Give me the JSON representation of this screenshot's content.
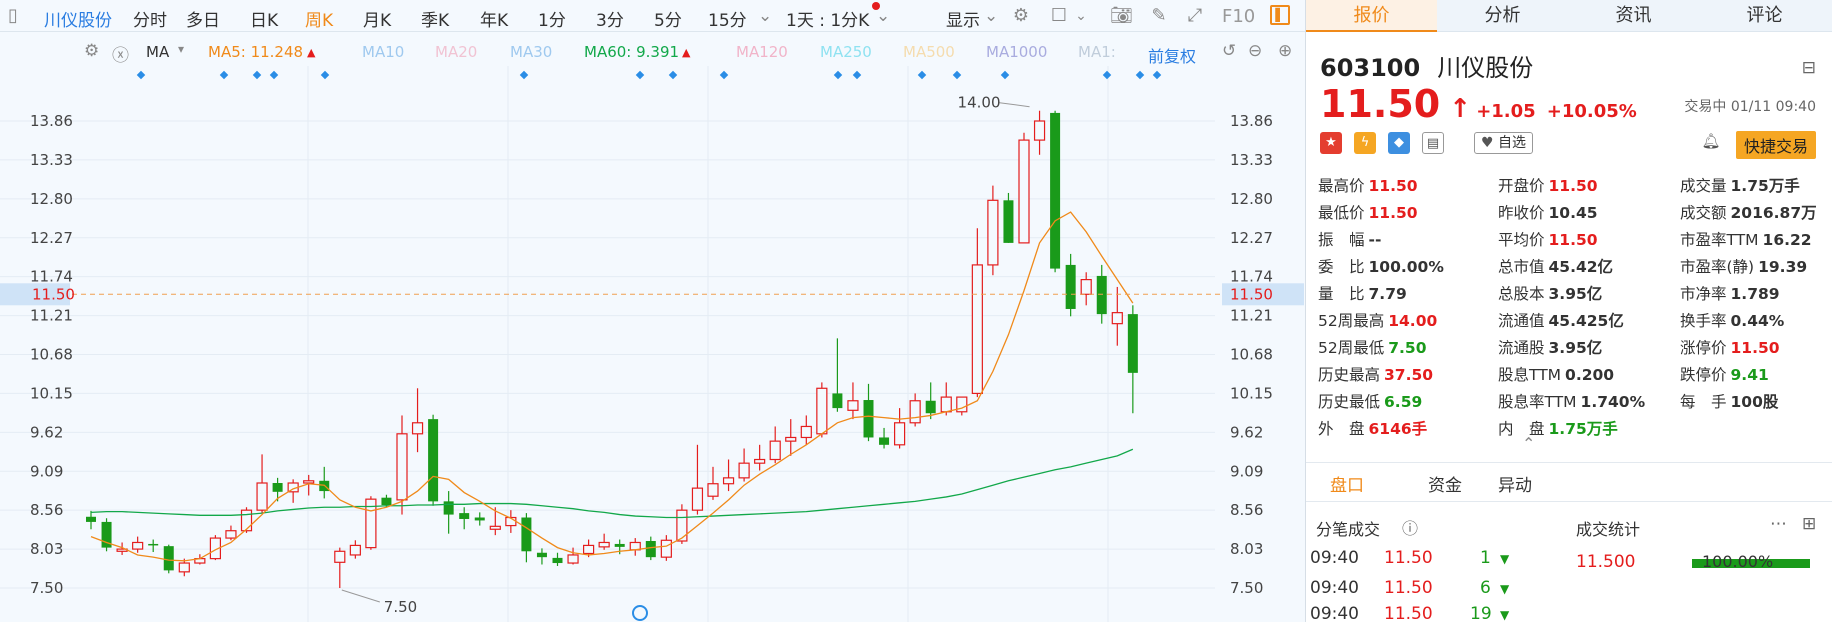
{
  "toolbar": {
    "stock_name": "川仪股份",
    "periods": [
      "分时",
      "多日",
      "日K",
      "周K",
      "月K",
      "季K",
      "年K",
      "1分",
      "3分",
      "5分",
      "15分"
    ],
    "active_period": "周K",
    "interval_label": "1天 : 1分K",
    "display_label": "显示",
    "f10_label": "F10"
  },
  "ma_bar": {
    "ma_label": "MA",
    "ma5_label": "MA5: 11.248",
    "ma10_label": "MA10",
    "ma20_label": "MA20",
    "ma30_label": "MA30",
    "ma60_label": "MA60: 9.391",
    "ma120_label": "MA120",
    "ma250_label": "MA250",
    "ma500_label": "MA500",
    "ma1000_label": "MA1000",
    "ma1_label": "MA1:",
    "adjust_label": "前复权",
    "colors": {
      "ma5": "#f08a1a",
      "ma60": "#12a84a",
      "ma10": "#7fb7ee",
      "ma20": "#f3b4c9",
      "ma30": "#8fc2ec",
      "ma120": "#f3a4c1",
      "ma250": "#7fe0f0",
      "ma500": "#f7d9a6",
      "ma1000": "#9b9fe0",
      "ma1": "#b8c7d8"
    }
  },
  "chart_data": {
    "type": "candlestick",
    "y_ticks": [
      "13.86",
      "13.33",
      "12.80",
      "12.27",
      "11.74",
      "11.21",
      "10.68",
      "10.15",
      "9.62",
      "9.09",
      "8.56",
      "8.03",
      "7.50"
    ],
    "ylim": [
      7.22,
      14.35
    ],
    "current_price_label": "11.50",
    "current_price": 11.5,
    "high_label": "14.00",
    "low_label": "7.50",
    "up_color": "#e41d1d",
    "down_color": "#1a9a1a",
    "candles": [
      [
        8.47,
        8.4,
        8.55,
        8.3
      ],
      [
        8.4,
        8.05,
        8.45,
        8.0
      ],
      [
        8.0,
        8.03,
        8.12,
        7.95
      ],
      [
        8.03,
        8.12,
        8.2,
        7.98
      ],
      [
        8.1,
        8.08,
        8.16,
        7.99
      ],
      [
        8.07,
        7.74,
        8.09,
        7.7
      ],
      [
        7.72,
        7.84,
        7.9,
        7.66
      ],
      [
        7.84,
        7.9,
        7.96,
        7.82
      ],
      [
        7.9,
        8.18,
        8.22,
        7.88
      ],
      [
        8.18,
        8.28,
        8.35,
        8.15
      ],
      [
        8.28,
        8.56,
        8.6,
        8.25
      ],
      [
        8.56,
        8.93,
        9.32,
        8.52
      ],
      [
        8.93,
        8.81,
        9.0,
        8.68
      ],
      [
        8.81,
        8.93,
        8.98,
        8.66
      ],
      [
        8.93,
        8.96,
        9.04,
        8.76
      ],
      [
        8.96,
        8.82,
        9.15,
        8.72
      ],
      [
        7.85,
        8.0,
        8.05,
        7.5
      ],
      [
        7.95,
        8.08,
        8.15,
        7.9
      ],
      [
        8.05,
        8.71,
        8.75,
        8.02
      ],
      [
        8.73,
        8.63,
        8.77,
        8.6
      ],
      [
        8.7,
        9.6,
        9.85,
        8.5
      ],
      [
        9.6,
        9.75,
        10.22,
        9.35
      ],
      [
        9.8,
        8.68,
        9.86,
        8.62
      ],
      [
        8.68,
        8.5,
        8.82,
        8.24
      ],
      [
        8.52,
        8.44,
        8.6,
        8.3
      ],
      [
        8.46,
        8.42,
        8.53,
        8.35
      ],
      [
        8.3,
        8.34,
        8.6,
        8.22
      ],
      [
        8.35,
        8.46,
        8.56,
        8.25
      ],
      [
        8.46,
        8.0,
        8.52,
        7.85
      ],
      [
        7.98,
        7.92,
        8.04,
        7.82
      ],
      [
        7.91,
        7.84,
        7.98,
        7.8
      ],
      [
        7.84,
        7.95,
        8.05,
        7.82
      ],
      [
        7.97,
        8.08,
        8.16,
        7.92
      ],
      [
        8.06,
        8.12,
        8.24,
        8.02
      ],
      [
        8.1,
        8.06,
        8.16,
        7.96
      ],
      [
        8.02,
        8.12,
        8.18,
        7.94
      ],
      [
        8.14,
        7.92,
        8.2,
        7.88
      ],
      [
        7.92,
        8.15,
        8.22,
        7.87
      ],
      [
        8.14,
        8.56,
        8.64,
        8.1
      ],
      [
        8.56,
        8.86,
        9.45,
        8.5
      ],
      [
        8.75,
        8.92,
        9.15,
        8.7
      ],
      [
        8.92,
        9.0,
        9.25,
        8.82
      ],
      [
        9.0,
        9.2,
        9.4,
        8.95
      ],
      [
        9.2,
        9.25,
        9.45,
        9.1
      ],
      [
        9.25,
        9.5,
        9.7,
        9.2
      ],
      [
        9.5,
        9.55,
        9.8,
        9.3
      ],
      [
        9.55,
        9.7,
        9.85,
        9.45
      ],
      [
        9.6,
        10.22,
        10.3,
        9.55
      ],
      [
        10.15,
        9.95,
        10.9,
        9.9
      ],
      [
        9.92,
        10.05,
        10.3,
        9.8
      ],
      [
        10.06,
        9.55,
        10.28,
        9.5
      ],
      [
        9.55,
        9.45,
        9.68,
        9.4
      ],
      [
        9.45,
        9.75,
        9.95,
        9.4
      ],
      [
        9.75,
        10.05,
        10.15,
        9.7
      ],
      [
        10.05,
        9.88,
        10.3,
        9.8
      ],
      [
        9.9,
        10.1,
        10.3,
        9.85
      ],
      [
        9.9,
        10.1,
        10.1,
        9.85
      ],
      [
        10.15,
        11.9,
        12.4,
        10.1
      ],
      [
        11.9,
        12.78,
        12.98,
        11.76
      ],
      [
        12.78,
        12.2,
        12.88,
        12.2
      ],
      [
        12.2,
        13.6,
        13.7,
        12.2
      ],
      [
        13.6,
        13.86,
        14.0,
        13.4
      ],
      [
        13.97,
        11.85,
        14.0,
        11.8
      ],
      [
        11.9,
        11.3,
        12.05,
        11.2
      ],
      [
        11.5,
        11.7,
        11.8,
        11.35
      ],
      [
        11.75,
        11.23,
        11.9,
        11.1
      ],
      [
        11.1,
        11.25,
        11.6,
        10.8
      ],
      [
        11.23,
        10.43,
        11.35,
        9.88
      ]
    ],
    "ma5": [
      8.2,
      8.12,
      8.05,
      7.95,
      7.92,
      7.88,
      7.87,
      7.9,
      8.02,
      8.12,
      8.3,
      8.5,
      8.72,
      8.85,
      8.92,
      8.9,
      8.7,
      8.6,
      8.55,
      8.6,
      8.68,
      8.82,
      9.02,
      8.98,
      8.8,
      8.68,
      8.55,
      8.45,
      8.32,
      8.18,
      8.05,
      7.98,
      7.95,
      7.97,
      8.0,
      8.02,
      8.05,
      8.07,
      8.18,
      8.35,
      8.52,
      8.7,
      8.9,
      9.05,
      9.18,
      9.32,
      9.45,
      9.6,
      9.75,
      9.82,
      9.84,
      9.82,
      9.8,
      9.82,
      9.85,
      9.9,
      9.95,
      10.05,
      10.45,
      10.95,
      11.55,
      12.2,
      12.5,
      12.62,
      12.35,
      12.02,
      11.7,
      11.38
    ],
    "ma60": [
      8.53,
      8.54,
      8.54,
      8.53,
      8.52,
      8.51,
      8.5,
      8.49,
      8.49,
      8.49,
      8.5,
      8.52,
      8.55,
      8.57,
      8.59,
      8.6,
      8.6,
      8.61,
      8.61,
      8.62,
      8.62,
      8.63,
      8.63,
      8.64,
      8.64,
      8.65,
      8.65,
      8.65,
      8.64,
      8.62,
      8.6,
      8.58,
      8.55,
      8.53,
      8.5,
      8.48,
      8.47,
      8.46,
      8.46,
      8.47,
      8.48,
      8.49,
      8.5,
      8.51,
      8.52,
      8.53,
      8.54,
      8.56,
      8.58,
      8.6,
      8.62,
      8.64,
      8.66,
      8.68,
      8.71,
      8.74,
      8.78,
      8.84,
      8.9,
      8.96,
      9.01,
      9.06,
      9.11,
      9.15,
      9.2,
      9.25,
      9.3,
      9.39
    ]
  },
  "side": {
    "tabs": [
      "报价",
      "分析",
      "资讯",
      "评论"
    ],
    "active_tab": "报价",
    "code": "603100",
    "name": "川仪股份",
    "price": "11.50",
    "change": "+1.05",
    "change_pct": "+10.05%",
    "trade_time": "交易中 01/11 09:40",
    "fav_label": "自选",
    "quick_trade": "快捷交易",
    "quote_rows": [
      [
        {
          "k": "最高价",
          "v": "11.50",
          "c": "up"
        },
        {
          "k": "开盘价",
          "v": "11.50",
          "c": "up"
        },
        {
          "k": "成交量",
          "v": "1.75万手",
          "c": ""
        }
      ],
      [
        {
          "k": "最低价",
          "v": "11.50",
          "c": "up"
        },
        {
          "k": "昨收价",
          "v": "10.45",
          "c": ""
        },
        {
          "k": "成交额",
          "v": "2016.87万",
          "c": ""
        }
      ],
      [
        {
          "k": "振　幅",
          "v": "--",
          "c": ""
        },
        {
          "k": "平均价",
          "v": "11.50",
          "c": "up"
        },
        {
          "k": "市盈率TTM",
          "v": "16.22",
          "c": ""
        }
      ],
      [
        {
          "k": "委　比",
          "v": "100.00%",
          "c": ""
        },
        {
          "k": "总市值",
          "v": "45.42亿",
          "c": ""
        },
        {
          "k": "市盈率(静)",
          "v": "19.39",
          "c": ""
        }
      ],
      [
        {
          "k": "量　比",
          "v": "7.79",
          "c": ""
        },
        {
          "k": "总股本",
          "v": "3.95亿",
          "c": ""
        },
        {
          "k": "市净率",
          "v": "1.789",
          "c": ""
        }
      ],
      [
        {
          "k": "52周最高",
          "v": "14.00",
          "c": "up"
        },
        {
          "k": "流通值",
          "v": "45.425亿",
          "c": ""
        },
        {
          "k": "换手率",
          "v": "0.44%",
          "c": ""
        }
      ],
      [
        {
          "k": "52周最低",
          "v": "7.50",
          "c": "down"
        },
        {
          "k": "流通股",
          "v": "3.95亿",
          "c": ""
        },
        {
          "k": "涨停价",
          "v": "11.50",
          "c": "up"
        }
      ],
      [
        {
          "k": "历史最高",
          "v": "37.50",
          "c": "up"
        },
        {
          "k": "股息TTM",
          "v": "0.200",
          "c": ""
        },
        {
          "k": "跌停价",
          "v": "9.41",
          "c": "down"
        }
      ],
      [
        {
          "k": "历史最低",
          "v": "6.59",
          "c": "down"
        },
        {
          "k": "股息率TTM",
          "v": "1.740%",
          "c": ""
        },
        {
          "k": "每　手",
          "v": "100股",
          "c": ""
        }
      ],
      [
        {
          "k": "外　盘",
          "v": "6146手",
          "c": "up"
        },
        {
          "k": "内　盘",
          "v": "1.75万手",
          "c": "down"
        },
        {
          "k": "",
          "v": "",
          "c": ""
        }
      ]
    ],
    "bottom_tabs": [
      "盘口",
      "资金",
      "异动"
    ],
    "active_bottom_tab": "盘口",
    "ticks_title": "分笔成交",
    "stats_title": "成交统计",
    "ticks": [
      {
        "time": "09:40",
        "price": "11.50",
        "vol": "1"
      },
      {
        "time": "09:40",
        "price": "11.50",
        "vol": "6"
      },
      {
        "time": "09:40",
        "price": "11.50",
        "vol": "19"
      }
    ],
    "stats": {
      "price": "11.500",
      "pct": "100.00%"
    }
  }
}
